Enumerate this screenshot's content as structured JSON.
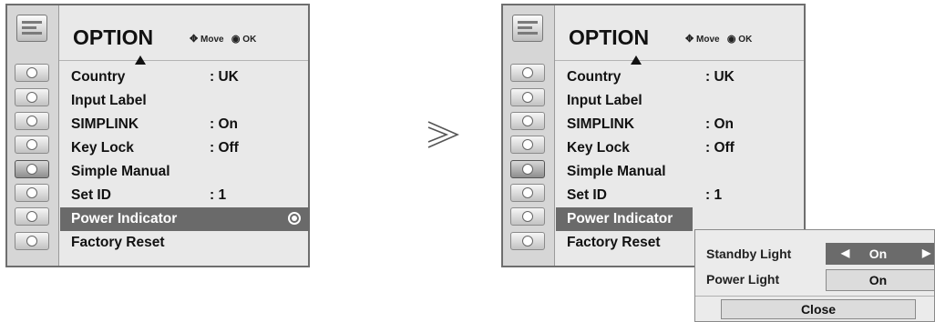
{
  "menu": {
    "title": "OPTION",
    "hint_move": "Move",
    "hint_ok": "OK",
    "items": [
      {
        "label": "Country",
        "value": ": UK"
      },
      {
        "label": "Input Label",
        "value": ""
      },
      {
        "label": "SIMPLINK",
        "value": ": On"
      },
      {
        "label": "Key Lock",
        "value": ": Off"
      },
      {
        "label": "Simple Manual",
        "value": ""
      },
      {
        "label": "Set ID",
        "value": ": 1"
      },
      {
        "label": "Power Indicator",
        "value": ""
      },
      {
        "label": "Factory Reset",
        "value": ""
      }
    ],
    "selected_index": 6,
    "side_icons": [
      "picture-icon",
      "screen-icon",
      "audio-icon",
      "time-icon",
      "option-icon",
      "lock-icon",
      "input-icon",
      "usb-icon"
    ],
    "active_side_icon": "option-icon"
  },
  "popup": {
    "standby_label": "Standby Light",
    "standby_value": "On",
    "power_label": "Power Light",
    "power_value": "On",
    "close_label": "Close"
  },
  "colors": {
    "selected_row": "#6a6a6a",
    "menu_bg": "#e9e9e9",
    "sidebar_bg": "#d6d6d6"
  }
}
